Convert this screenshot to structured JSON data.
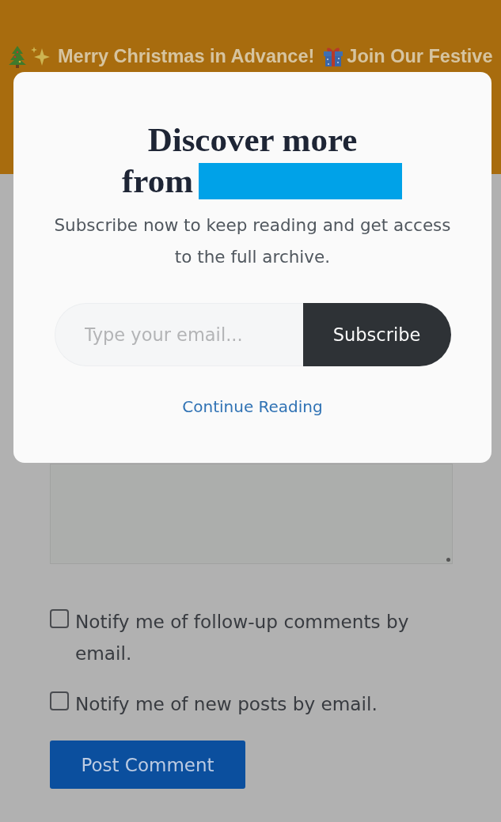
{
  "banner": {
    "texts": [
      "Merry Christmas in Advance!",
      "Join Our Festive"
    ]
  },
  "modal": {
    "title": "Discover more from",
    "subtitle": "Subscribe now to keep reading and get access to the full archive.",
    "email_field": {
      "placeholder": "Type your email..."
    },
    "subscribe_button": "Subscribe",
    "continue_link": "Continue Reading"
  },
  "comment_form": {
    "checkboxes": [
      {
        "label": "Notify me of follow-up comments by email.",
        "checked": false
      },
      {
        "label": "Notify me of new posts by email.",
        "checked": false
      }
    ],
    "submit_button": "Post Comment"
  }
}
